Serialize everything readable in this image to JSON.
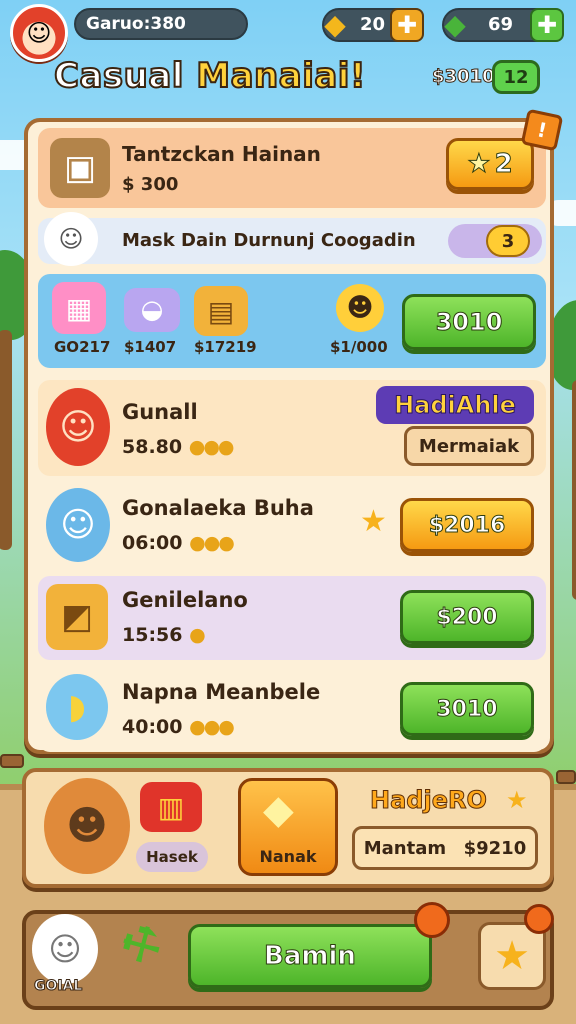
{
  "header": {
    "player_name": "Garuo:380",
    "coins": "20",
    "gems": "69",
    "coins_icon": "gold-coins-icon",
    "gems_icon": "green-gem-icon"
  },
  "title": {
    "main": "Casual",
    "accent": "Manaiai!",
    "money": "$3010",
    "badge": "12"
  },
  "shop": {
    "featured": {
      "name": "Tantzckan Hainan",
      "price": "$ 300",
      "button": "2",
      "corner_badge": "!"
    },
    "banner": {
      "text": "Mask Dain Durnunj Coogadin",
      "badge": "3"
    },
    "bundle": {
      "items": [
        {
          "label": "GO217",
          "icon": "gift-box-icon"
        },
        {
          "label": "$1407",
          "icon": "basket-icon"
        },
        {
          "label": "$17219",
          "icon": "wood-crate-icon"
        },
        {
          "label": "$1/000",
          "icon": "green-hat-smiley-icon"
        }
      ],
      "button": "3010"
    },
    "items": [
      {
        "name": "Gunall",
        "sub": "58.80",
        "coins": "●●●",
        "tag_title": "HadiAhle",
        "tag_sub": "Mermaiak"
      },
      {
        "name": "Gonalaeka Buha",
        "sub": "06:00",
        "coins": "●●●",
        "button": "$2016"
      },
      {
        "name": "Genilelano",
        "sub": "15:56",
        "coins": "●",
        "button": "$200"
      },
      {
        "name": "Napna Meanbele",
        "sub": "40:00",
        "coins": "●●●",
        "button": "3010"
      }
    ]
  },
  "bottom": {
    "chest_label": "Hasek",
    "center_label": "Nanak",
    "promo_title": "HadjeRO",
    "promo_sub": "Mantam",
    "promo_price": "$9210"
  },
  "nav": {
    "left_label": "GOIAL",
    "main_button": "Bamin",
    "star_icon": "star-icon"
  }
}
